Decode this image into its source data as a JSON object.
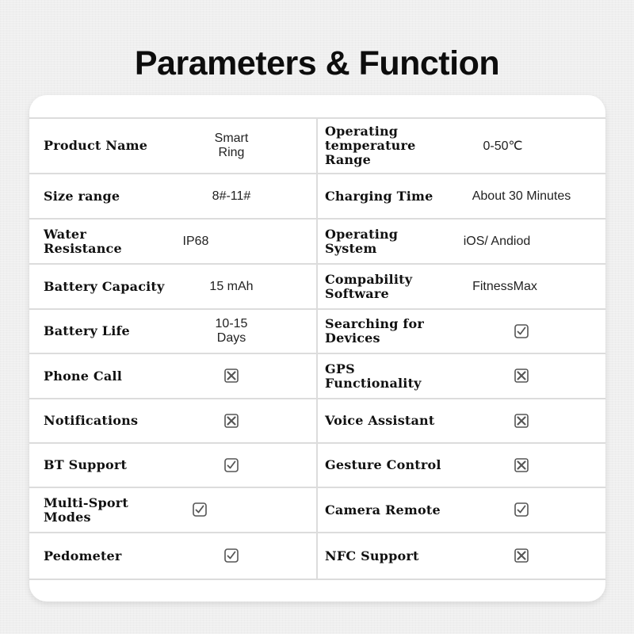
{
  "title": "Parameters & Function",
  "rows": [
    {
      "left": {
        "label": "Product Name",
        "type": "text",
        "value": "Smart Ring"
      },
      "right": {
        "label": "Operating temperature Range",
        "type": "text",
        "value": "0-50℃"
      }
    },
    {
      "left": {
        "label": "Size range",
        "type": "text",
        "value": "8#-11#"
      },
      "right": {
        "label": "Charging Time",
        "type": "text",
        "value": "About 30 Minutes"
      }
    },
    {
      "left": {
        "label": "Water Resistance",
        "type": "text",
        "value": "IP68"
      },
      "right": {
        "label": "Operating System",
        "type": "text",
        "value": "iOS/ Andiod"
      }
    },
    {
      "left": {
        "label": "Battery Capacity",
        "type": "text",
        "value": "15 mAh"
      },
      "right": {
        "label": "Compability Software",
        "type": "text",
        "value": "FitnessMax"
      }
    },
    {
      "left": {
        "label": "Battery Life",
        "type": "text",
        "value": "10-15 Days"
      },
      "right": {
        "label": "Searching for Devices",
        "type": "check",
        "value": true
      }
    },
    {
      "left": {
        "label": "Phone Call",
        "type": "check",
        "value": false
      },
      "right": {
        "label": "GPS Functionality",
        "type": "check",
        "value": false
      }
    },
    {
      "left": {
        "label": "Notifications",
        "type": "check",
        "value": false
      },
      "right": {
        "label": "Voice Assistant",
        "type": "check",
        "value": false
      }
    },
    {
      "left": {
        "label": "BT Support",
        "type": "check",
        "value": true
      },
      "right": {
        "label": "Gesture Control",
        "type": "check",
        "value": false
      }
    },
    {
      "left": {
        "label": "Multi-Sport Modes",
        "type": "check",
        "value": true
      },
      "right": {
        "label": "Camera Remote",
        "type": "check",
        "value": true
      }
    },
    {
      "left": {
        "label": "Pedometer",
        "type": "check",
        "value": true
      },
      "right": {
        "label": "NFC Support",
        "type": "check",
        "value": false
      }
    }
  ],
  "icons": {
    "yes": "checked-box-icon",
    "no": "crossed-box-icon"
  },
  "colors": {
    "icon": "#555555",
    "divider": "#dcdcdc",
    "background": "#efefef",
    "card": "#ffffff"
  }
}
